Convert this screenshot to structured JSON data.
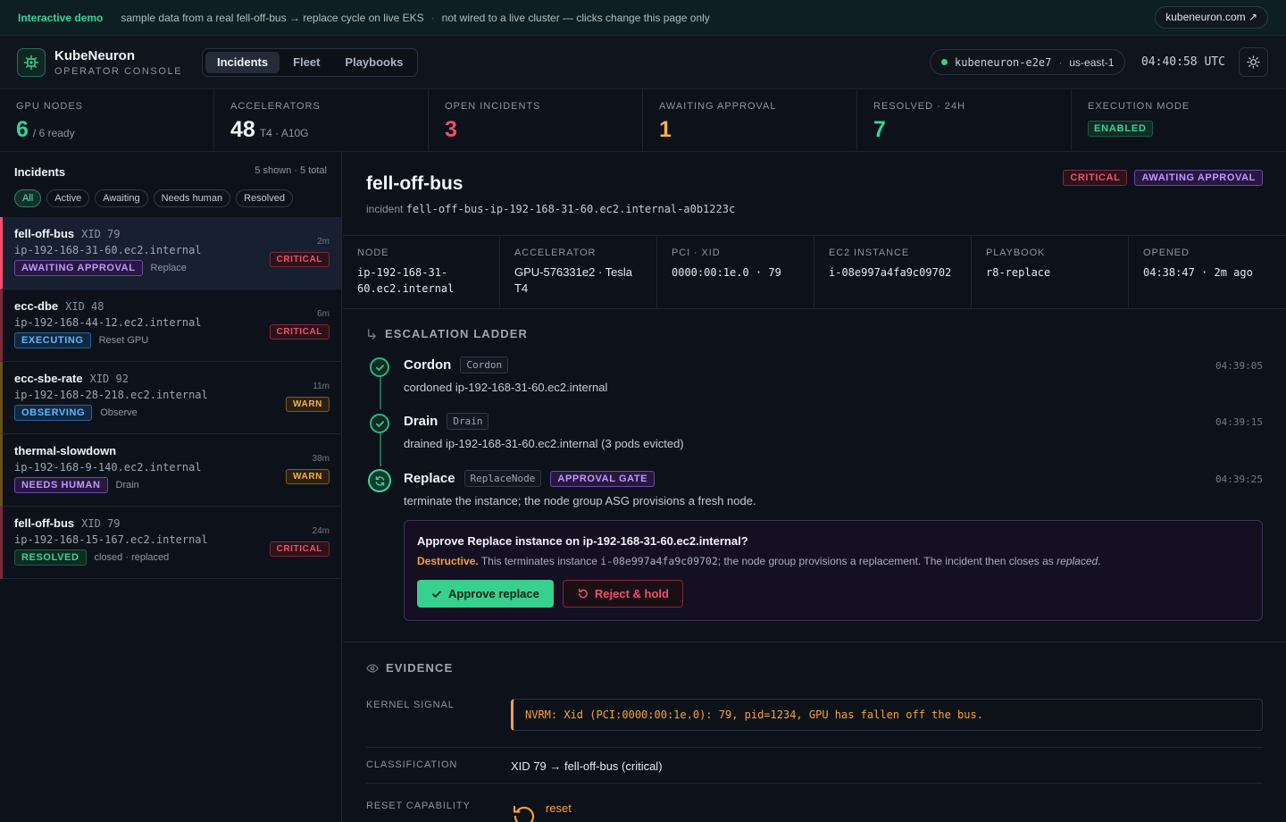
{
  "banner": {
    "tag": "Interactive demo",
    "text1": "sample data from a real fell-off-bus → replace cycle on live EKS",
    "sep": "·",
    "text2": "not wired to a live cluster — clicks change this page only",
    "link": "kubeneuron.com ↗"
  },
  "header": {
    "app_name": "KubeNeuron",
    "app_sub": "OPERATOR CONSOLE",
    "tabs": [
      "Incidents",
      "Fleet",
      "Playbooks"
    ],
    "cluster": "kubeneuron-e2e7",
    "cluster_sep": "·",
    "region": "us-east-1",
    "clock": "04:40:58 UTC"
  },
  "stats": [
    {
      "label": "GPU NODES",
      "value": "6",
      "sub": "/ 6 ready"
    },
    {
      "label": "ACCELERATORS",
      "value": "48",
      "sub": "T4 · A10G"
    },
    {
      "label": "OPEN INCIDENTS",
      "value": "3",
      "sub": ""
    },
    {
      "label": "AWAITING APPROVAL",
      "value": "1",
      "sub": ""
    },
    {
      "label": "RESOLVED · 24H",
      "value": "7",
      "sub": ""
    },
    {
      "label": "EXECUTION MODE",
      "value": "ENABLED",
      "sub": ""
    }
  ],
  "incidents_panel": {
    "title": "Incidents",
    "count": "5 shown · 5 total",
    "filters": [
      "All",
      "Active",
      "Awaiting",
      "Needs human",
      "Resolved"
    ],
    "items": [
      {
        "title": "fell-off-bus",
        "xid": "XID 79",
        "host": "ip-192-168-31-60.ec2.internal",
        "status": "AWAITING APPROVAL",
        "action": "Replace",
        "age": "2m",
        "severity": "CRITICAL"
      },
      {
        "title": "ecc-dbe",
        "xid": "XID 48",
        "host": "ip-192-168-44-12.ec2.internal",
        "status": "EXECUTING",
        "action": "Reset GPU",
        "age": "6m",
        "severity": "CRITICAL"
      },
      {
        "title": "ecc-sbe-rate",
        "xid": "XID 92",
        "host": "ip-192-168-28-218.ec2.internal",
        "status": "OBSERVING",
        "action": "Observe",
        "age": "11m",
        "severity": "WARN"
      },
      {
        "title": "thermal-slowdown",
        "xid": "",
        "host": "ip-192-168-9-140.ec2.internal",
        "status": "NEEDS HUMAN",
        "action": "Drain",
        "age": "38m",
        "severity": "WARN"
      },
      {
        "title": "fell-off-bus",
        "xid": "XID 79",
        "host": "ip-192-168-15-167.ec2.internal",
        "status": "RESOLVED",
        "action": "closed · replaced",
        "age": "24m",
        "severity": "CRITICAL"
      }
    ]
  },
  "detail": {
    "title": "fell-off-bus",
    "incident_label": "incident",
    "incident_id": "fell-off-bus-ip-192-168-31-60.ec2.internal-a0b1223c",
    "severity": "CRITICAL",
    "status": "AWAITING APPROVAL",
    "meta": [
      {
        "key": "NODE",
        "value": "ip-192-168-31-60.ec2.internal"
      },
      {
        "key": "ACCELERATOR",
        "value": "GPU-576331e2 · Tesla T4"
      },
      {
        "key": "PCI · XID",
        "value": "0000:00:1e.0 · 79"
      },
      {
        "key": "EC2 INSTANCE",
        "value": "i-08e997a4fa9c09702"
      },
      {
        "key": "PLAYBOOK",
        "value": "r8-replace"
      },
      {
        "key": "OPENED",
        "value": "04:38:47 · 2m ago"
      }
    ],
    "ladder_title": "ESCALATION LADDER",
    "steps": [
      {
        "name": "Cordon",
        "tag": "Cordon",
        "desc": "cordoned ip-192-168-31-60.ec2.internal",
        "time": "04:39:05"
      },
      {
        "name": "Drain",
        "tag": "Drain",
        "desc": "drained ip-192-168-31-60.ec2.internal (3 pods evicted)",
        "time": "04:39:15"
      },
      {
        "name": "Replace",
        "tag": "ReplaceNode",
        "gate": "APPROVAL GATE",
        "desc": "terminate the instance; the node group ASG provisions a fresh node.",
        "time": "04:39:25"
      }
    ],
    "approval": {
      "question": "Approve Replace instance on ip-192-168-31-60.ec2.internal?",
      "warn_lead": "Destructive.",
      "warn_text1": "This terminates instance",
      "warn_instance": "i-08e997a4fa9c09702",
      "warn_text2": "; the node group provisions a replacement. The incident then closes as",
      "warn_italic": "replaced",
      "warn_end": ".",
      "approve_label": "Approve replace",
      "reject_label": "Reject & hold"
    },
    "evidence_title": "EVIDENCE",
    "evidence": {
      "kernel_label": "KERNEL SIGNAL",
      "kernel_value": "NVRM: Xid (PCI:0000:00:1e.0): 79, pid=1234, GPU has fallen off the bus.",
      "class_label": "CLASSIFICATION",
      "class_value": "XID 79 → fell-off-bus (critical)",
      "reset_label": "RESET CAPABILITY",
      "reset_value": "reset"
    }
  },
  "colors": {
    "accent": "#37d39a",
    "critical": "#f0506e",
    "warn": "#f5b14a",
    "approval": "#c197ff"
  }
}
